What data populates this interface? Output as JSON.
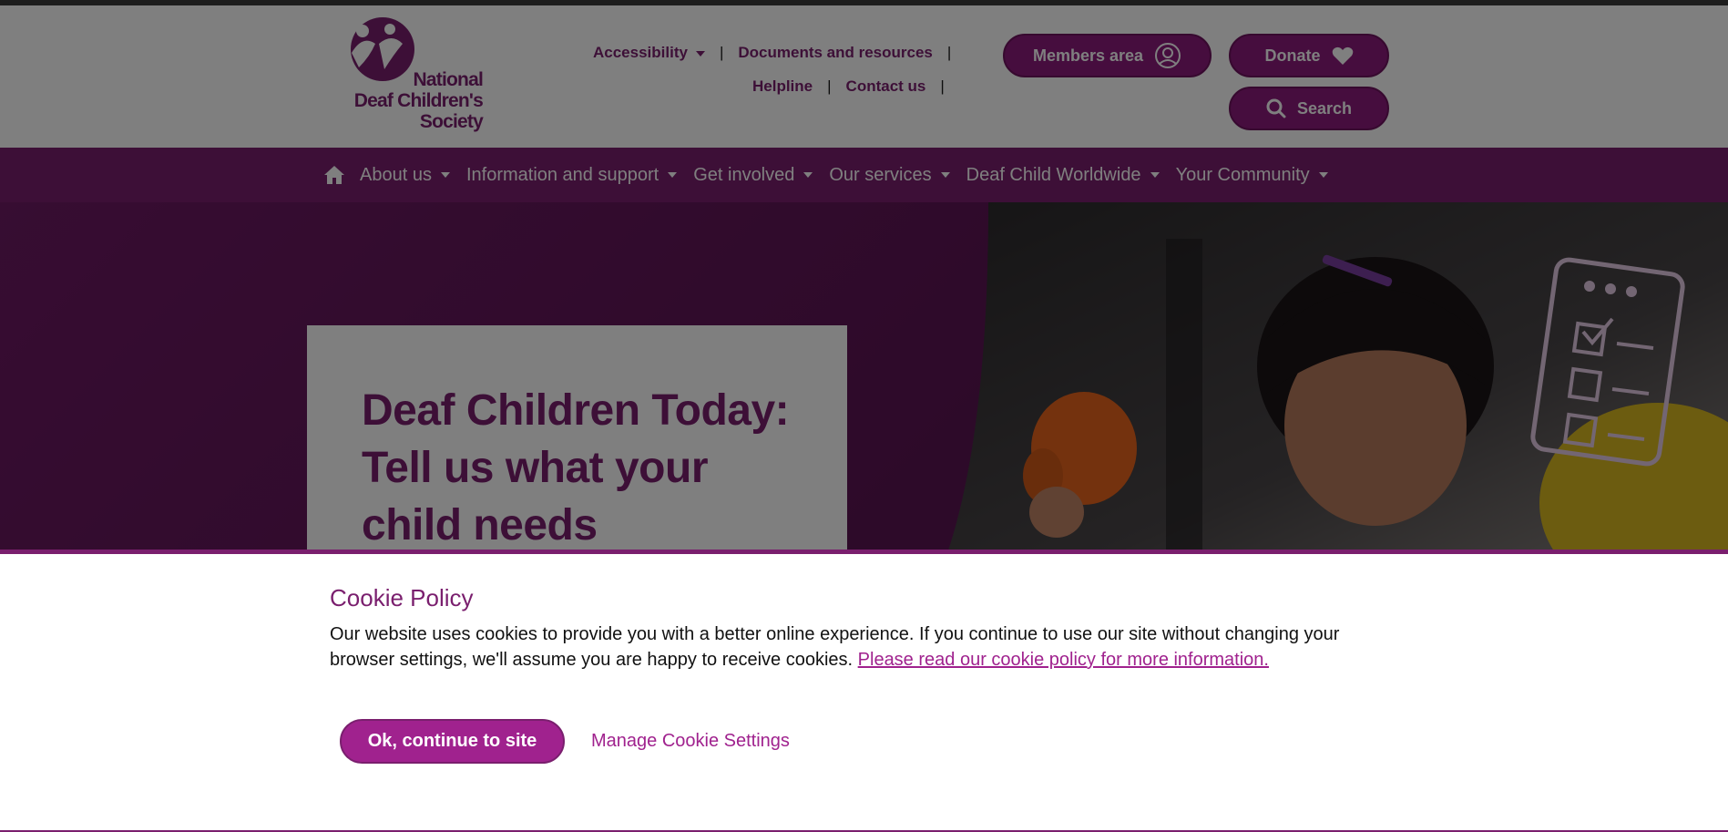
{
  "logo": {
    "line1": "National",
    "line2": "Deaf Children's",
    "line3": "Society"
  },
  "utility": {
    "accessibility": "Accessibility",
    "documents": "Documents and resources",
    "helpline": "Helpline",
    "contact": "Contact us"
  },
  "actions": {
    "members": "Members area",
    "donate": "Donate",
    "search": "Search"
  },
  "nav": {
    "items": [
      "About us",
      "Information and support",
      "Get involved",
      "Our services",
      "Deaf Child Worldwide",
      "Your Community"
    ]
  },
  "hero": {
    "title": "Deaf Children Today: Tell us what your child needs"
  },
  "cookie": {
    "title": "Cookie Policy",
    "text": "Our website uses cookies to provide you with a better online experience. If you continue to use our site without changing your browser settings, we'll assume you are happy to receive cookies.",
    "link": "Please read our cookie policy for more information.",
    "ok": "Ok, continue to site",
    "manage": "Manage Cookie Settings"
  },
  "colors": {
    "brand": "#7a1f6e",
    "button": "#a0228e"
  }
}
